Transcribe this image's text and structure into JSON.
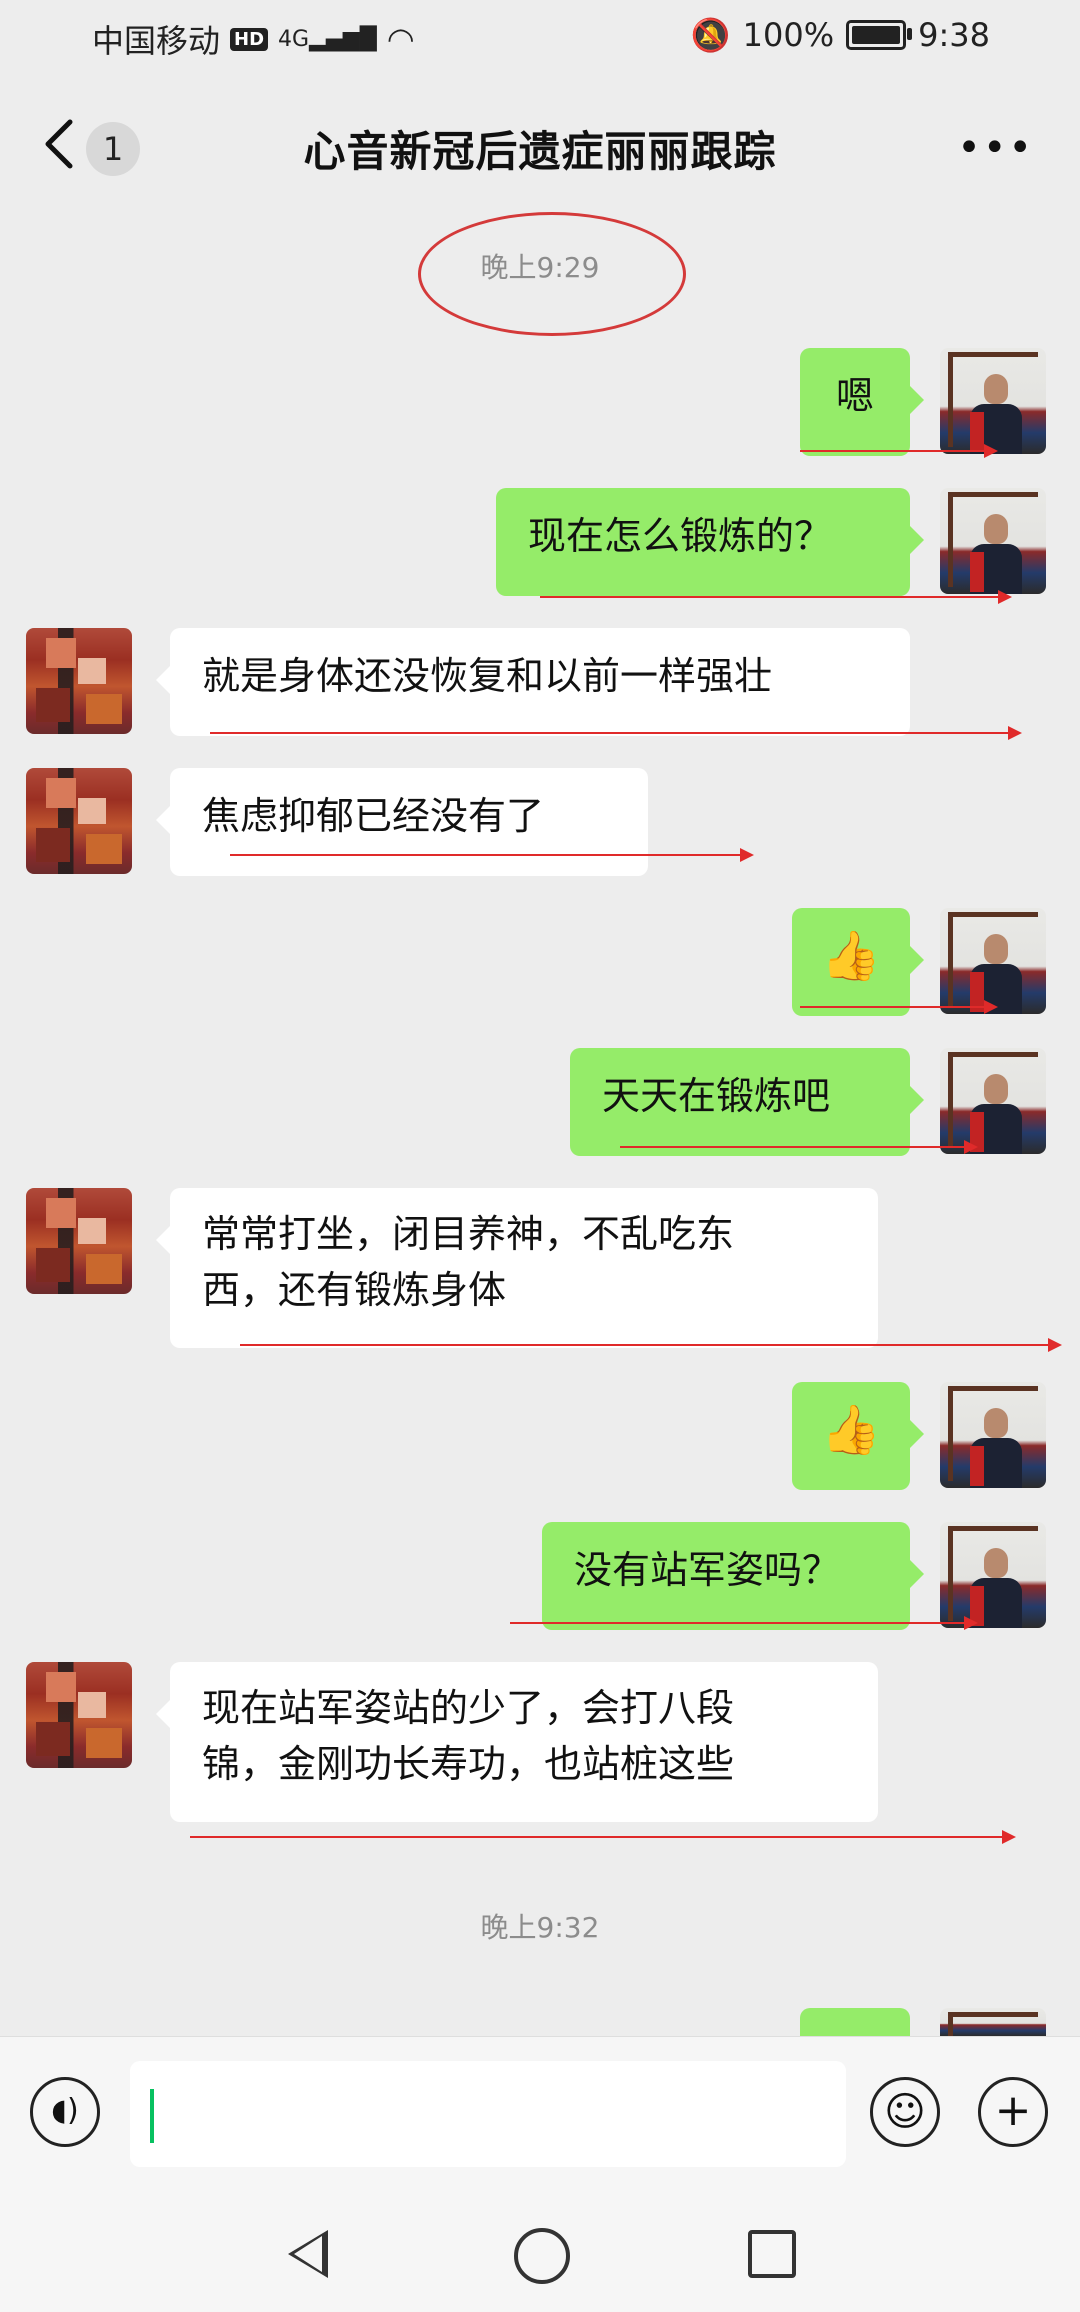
{
  "statusbar": {
    "carrier": "中国移动",
    "hd": "HD",
    "network": "4G",
    "battery": "100%",
    "time": "9:38"
  },
  "titlebar": {
    "back_icon": "chevron-left-icon",
    "unread_count": "1",
    "title": "心音新冠后遗症丽丽跟踪",
    "more_icon": "more-dots-icon"
  },
  "timestamps": [
    "晚上9:29",
    "晚上9:32"
  ],
  "messages": [
    {
      "from": "me",
      "text": "嗯"
    },
    {
      "from": "me",
      "text": "现在怎么锻炼的？"
    },
    {
      "from": "them",
      "text": "就是身体还没恢复和以前一样强壮"
    },
    {
      "from": "them",
      "text": "焦虑抑郁已经没有了"
    },
    {
      "from": "me",
      "text": "👍"
    },
    {
      "from": "me",
      "text": "天天在锻炼吧"
    },
    {
      "from": "them",
      "text": "常常打坐，闭目养神，不乱吃东\n西，还有锻炼身体"
    },
    {
      "from": "me",
      "text": "👍"
    },
    {
      "from": "me",
      "text": "没有站军姿吗？"
    },
    {
      "from": "them",
      "text": "现在站军姿站的少了，会打八段\n锦，金刚功长寿功，也站桩这些"
    }
  ],
  "inputbar": {
    "voice_icon": "voice-icon",
    "input_value": "",
    "emoji_icon": "emoji-icon",
    "plus_icon": "plus-icon"
  },
  "colors": {
    "my_bubble": "#95ec69",
    "their_bubble": "#ffffff",
    "background": "#ededed",
    "annotation": "#e02a2a"
  }
}
